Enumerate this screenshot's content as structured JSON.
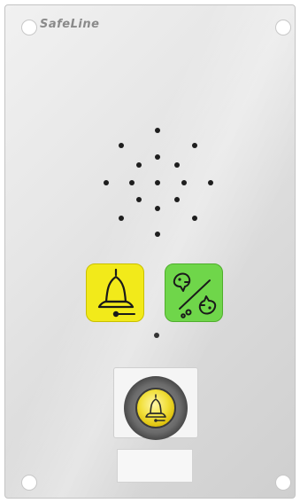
{
  "brand": {
    "name": "SafeLine"
  },
  "icons": {
    "alarm_key": "bell-icon",
    "speech_key": "two-way-speech-icon",
    "push_button": "bell-icon"
  },
  "colors": {
    "alarm_key": "#f2ea1a",
    "speech_key": "#6fd64a",
    "push_button": "#f1df3a"
  }
}
